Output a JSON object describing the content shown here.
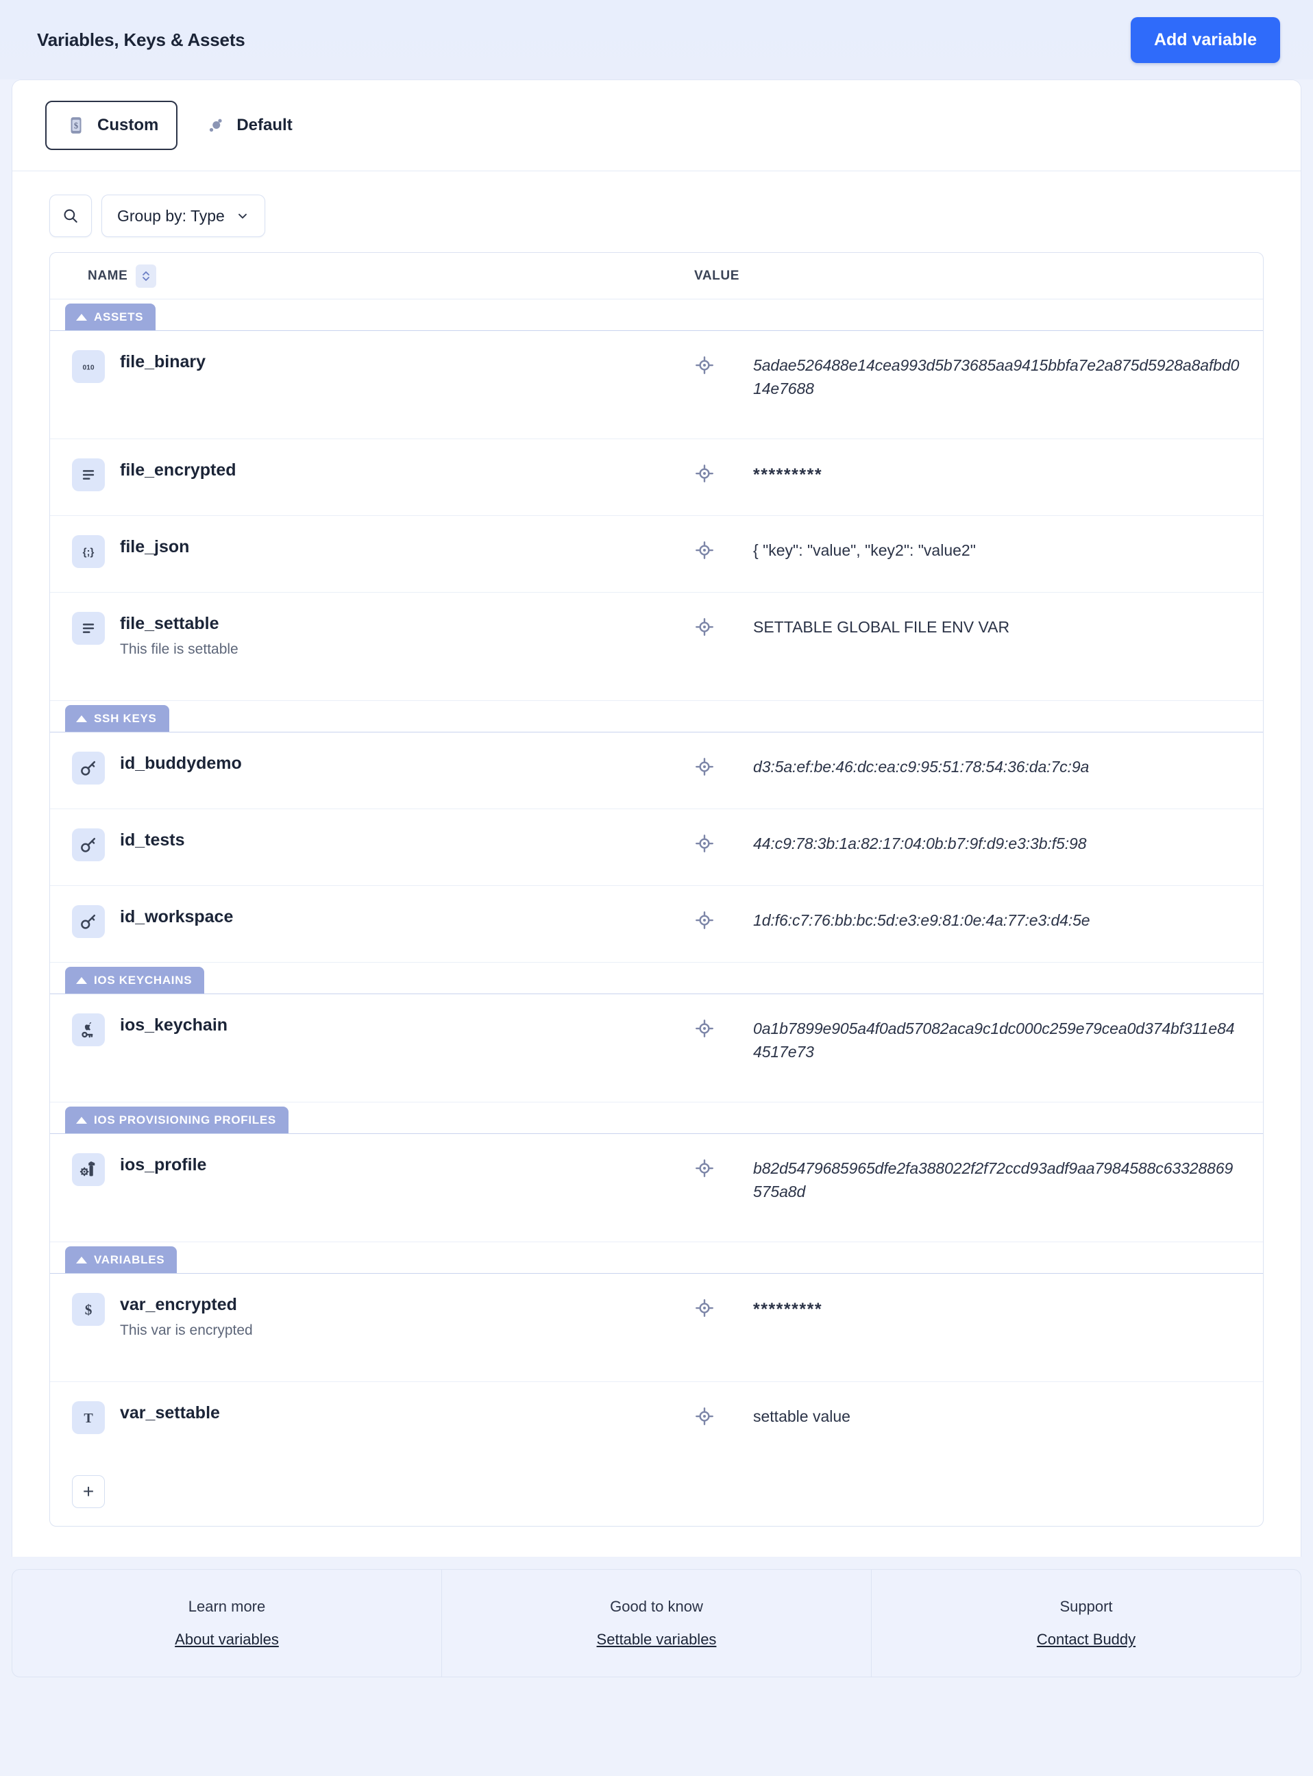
{
  "header": {
    "title": "Variables, Keys & Assets",
    "add_button_label": "Add variable",
    "accent_color": "#2f6bfa"
  },
  "tabs": [
    {
      "label": "Custom",
      "icon": "custom-variable-icon",
      "active": true
    },
    {
      "label": "Default",
      "icon": "default-variable-icon",
      "active": false
    }
  ],
  "toolbar": {
    "search_icon": "search-icon",
    "group_by_label": "Group by: Type",
    "chevron_icon": "chevron-down-icon"
  },
  "table": {
    "columns": {
      "name": "NAME",
      "value": "VALUE"
    },
    "sort_icon": "sort-updown-icon",
    "groups": [
      {
        "label": "ASSETS",
        "rows": [
          {
            "name": "file_binary",
            "description": "",
            "icon": "binary-file-icon",
            "value": "5adae526488e14cea993d5b73685aa9415bbfa7e2a875d5928a8afbd014e7688",
            "value_style": "italic",
            "target_icon": "crosshair-icon"
          },
          {
            "name": "file_encrypted",
            "description": "",
            "icon": "text-file-icon",
            "value": "*********",
            "value_style": "stars",
            "target_icon": "crosshair-icon"
          },
          {
            "name": "file_json",
            "description": "",
            "icon": "json-file-icon",
            "value": "{ \"key\": \"value\", \"key2\": \"value2\"",
            "value_style": "plain",
            "target_icon": "crosshair-icon"
          },
          {
            "name": "file_settable",
            "description": "This file is settable",
            "icon": "text-file-icon",
            "value": "SETTABLE GLOBAL FILE ENV VAR",
            "value_style": "plain",
            "target_icon": "crosshair-icon"
          }
        ]
      },
      {
        "label": "SSH KEYS",
        "rows": [
          {
            "name": "id_buddydemo",
            "description": "",
            "icon": "ssh-key-icon",
            "value": "d3:5a:ef:be:46:dc:ea:c9:95:51:78:54:36:da:7c:9a",
            "value_style": "italic",
            "target_icon": "crosshair-icon"
          },
          {
            "name": "id_tests",
            "description": "",
            "icon": "ssh-key-icon",
            "value": "44:c9:78:3b:1a:82:17:04:0b:b7:9f:d9:e3:3b:f5:98",
            "value_style": "italic",
            "target_icon": "crosshair-icon"
          },
          {
            "name": "id_workspace",
            "description": "",
            "icon": "ssh-key-icon",
            "value": "1d:f6:c7:76:bb:bc:5d:e3:e9:81:0e:4a:77:e3:d4:5e",
            "value_style": "italic",
            "target_icon": "crosshair-icon"
          }
        ]
      },
      {
        "label": "IOS KEYCHAINS",
        "rows": [
          {
            "name": "ios_keychain",
            "description": "",
            "icon": "ios-keychain-icon",
            "value": "0a1b7899e905a4f0ad57082aca9c1dc000c259e79cea0d374bf311e844517e73",
            "value_style": "italic",
            "target_icon": "crosshair-icon"
          }
        ]
      },
      {
        "label": "IOS PROVISIONING PROFILES",
        "rows": [
          {
            "name": "ios_profile",
            "description": "",
            "icon": "ios-profile-icon",
            "value": "b82d5479685965dfe2fa388022f2f72ccd93adf9aa7984588c63328869575a8d",
            "value_style": "italic",
            "target_icon": "crosshair-icon"
          }
        ]
      },
      {
        "label": "VARIABLES",
        "rows": [
          {
            "name": "var_encrypted",
            "description": "This var is encrypted",
            "icon": "dollar-variable-icon",
            "value": "*********",
            "value_style": "stars",
            "target_icon": "crosshair-icon"
          },
          {
            "name": "var_settable",
            "description": "",
            "icon": "text-variable-icon",
            "value": "settable value",
            "value_style": "plain",
            "target_icon": "crosshair-icon"
          }
        ]
      }
    ],
    "add_row_label": "+"
  },
  "footer": {
    "columns": [
      {
        "label": "Learn more",
        "link": "About variables"
      },
      {
        "label": "Good to know",
        "link": "Settable variables"
      },
      {
        "label": "Support",
        "link": "Contact Buddy"
      }
    ]
  }
}
